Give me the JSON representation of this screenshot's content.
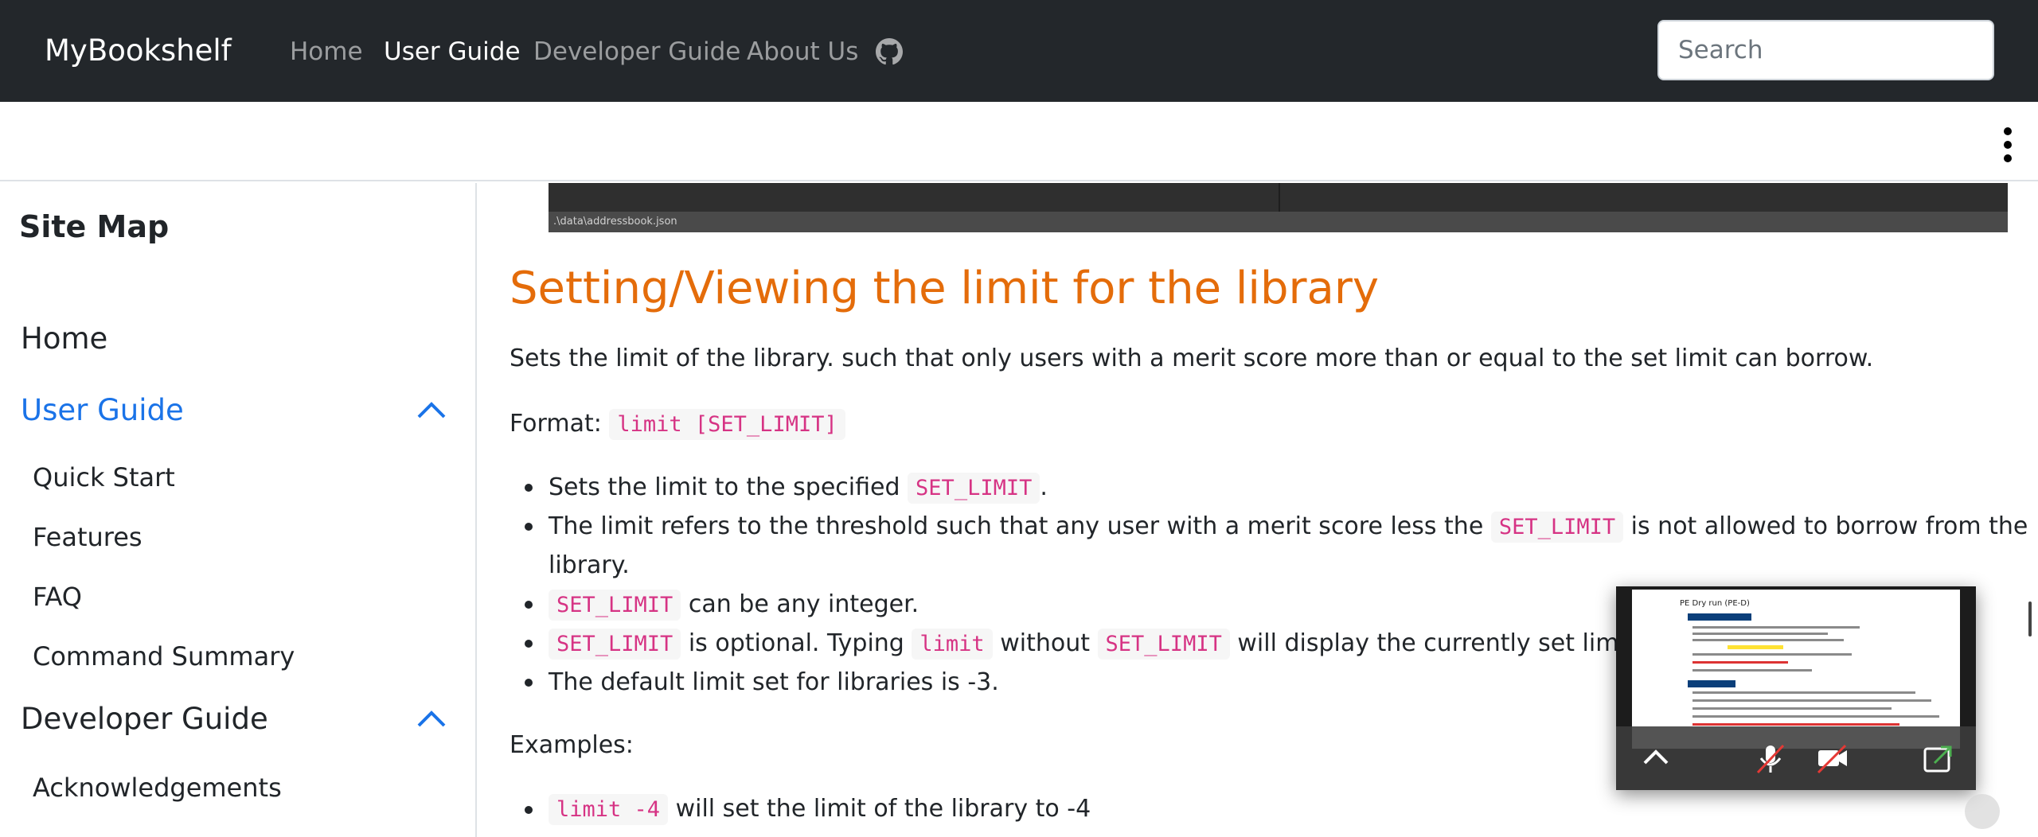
{
  "navbar": {
    "brand": "MyBookshelf",
    "links": [
      {
        "label": "Home",
        "active": false
      },
      {
        "label": "User Guide",
        "active": true
      },
      {
        "label": "Developer Guide",
        "active": false
      },
      {
        "label": "About Us",
        "active": false
      }
    ],
    "github_icon": "github-icon",
    "search_placeholder": "Search"
  },
  "subheader": {
    "menu_icon": "kebab-menu-icon"
  },
  "sidebar": {
    "title": "Site Map",
    "items": [
      {
        "label": "Home"
      },
      {
        "label": "User Guide",
        "active": true,
        "expanded": true,
        "children": [
          "Quick Start",
          "Features",
          "FAQ",
          "Command Summary"
        ]
      },
      {
        "label": "Developer Guide",
        "expanded": true,
        "children": [
          "Acknowledgements"
        ]
      }
    ],
    "accent_color": "#1a73e8"
  },
  "main": {
    "image_caption": ".\\data\\addressbook.json",
    "heading": "Setting/Viewing the limit for the library",
    "description": "Sets the limit of the library. such that only users with a merit score more than or equal to the set limit can borrow.",
    "format_label": "Format:",
    "format_code": "limit [SET_LIMIT]",
    "bullets": [
      {
        "t1": "Sets the limit to the specified ",
        "c1": "SET_LIMIT",
        "t2": "."
      },
      {
        "t1": "The limit refers to the threshold such that any user with a merit score less the ",
        "c1": "SET_LIMIT",
        "t2": " is not allowed to borrow from the",
        "t3": "library."
      },
      {
        "c1": "SET_LIMIT",
        "t2": " can be any integer."
      },
      {
        "c1": "SET_LIMIT",
        "t2": " is optional. Typing ",
        "c2": "limit",
        "t3": " without ",
        "c3": "SET_LIMIT",
        "t4": " will display the currently set limit."
      },
      {
        "t1": "The default limit set for libraries is -3."
      }
    ],
    "examples_label": "Examples:",
    "examples": [
      {
        "code": "limit -4",
        "text": " will set the limit of the library to -4"
      }
    ],
    "heading_color": "#e46c0a",
    "code_color": "#d63384"
  },
  "video_preview": {
    "doc_title": "PE Dry run (PE-D)",
    "controls": [
      "chevron-up-icon",
      "mic-off-icon",
      "camera-off-icon",
      "share-icon"
    ]
  }
}
